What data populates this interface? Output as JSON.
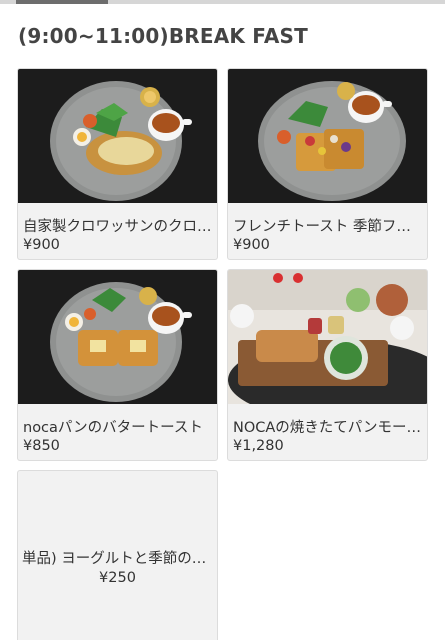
{
  "section": {
    "title": "(9:00~11:00)BREAK FAST"
  },
  "items": [
    {
      "name": "自家製クロワッサンのクロックムッシュ",
      "price": "¥900",
      "photo": "croissant-plate-photo"
    },
    {
      "name": "フレンチトースト 季節フルーツ",
      "price": "¥900",
      "photo": "french-toast-plate-photo"
    },
    {
      "name": "nocaパンのバタートースト",
      "price": "¥850",
      "photo": "butter-toast-plate-photo"
    },
    {
      "name": "NOCAの焼きたてパンモーニング",
      "price": "¥1,280",
      "photo": "bread-morning-set-photo"
    },
    {
      "name": "単品) ヨーグルトと季節のフルーツ",
      "price": "¥250"
    }
  ],
  "colors": {
    "photo_background": "#1c1c1c",
    "plate": "#8f9190",
    "card_background": "#f2f2f2"
  }
}
